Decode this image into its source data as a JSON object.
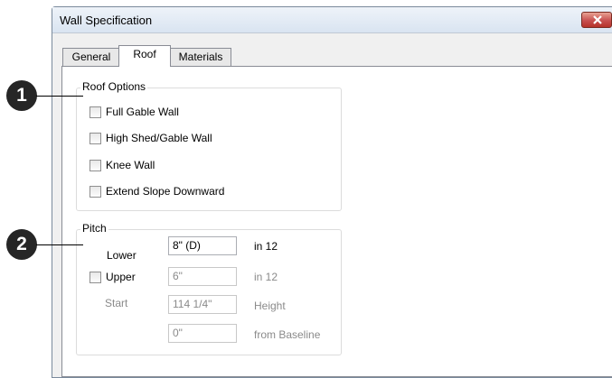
{
  "window": {
    "title": "Wall Specification",
    "close_label": "×"
  },
  "tabs": [
    {
      "label": "General",
      "active": false
    },
    {
      "label": "Roof",
      "active": true
    },
    {
      "label": "Materials",
      "active": false
    }
  ],
  "roof_options": {
    "legend": "Roof Options",
    "checkboxes": [
      {
        "label": "Full Gable Wall",
        "checked": false
      },
      {
        "label": "High Shed/Gable Wall",
        "checked": false
      },
      {
        "label": "Knee Wall",
        "checked": false
      },
      {
        "label": "Extend Slope Downward",
        "checked": false
      }
    ]
  },
  "pitch": {
    "legend": "Pitch",
    "lower_label": "Lower",
    "lower_value": "8\" (D)",
    "lower_unit": "in 12",
    "upper_label": "Upper",
    "upper_checked": false,
    "upper_value": "6\"",
    "upper_unit": "in 12",
    "start_label": "Start",
    "start_value": "114 1/4\"",
    "start_unit": "Height",
    "baseline_value": "0\"",
    "baseline_unit": "from Baseline"
  },
  "callouts": [
    "1",
    "2"
  ],
  "colors": {
    "callout_bg": "#262626",
    "close_button": "#c75050"
  }
}
